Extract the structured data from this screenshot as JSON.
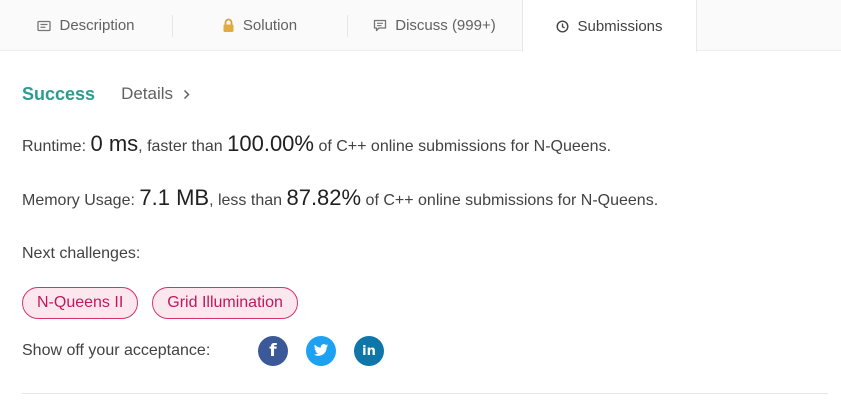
{
  "tabs": [
    {
      "label": "Description",
      "icon": "description-icon"
    },
    {
      "label": "Solution",
      "icon": "lock-icon"
    },
    {
      "label": "Discuss (999+)",
      "icon": "comment-icon"
    },
    {
      "label": "Submissions",
      "icon": "clock-icon",
      "active": true
    }
  ],
  "result": {
    "status": "Success",
    "details_label": "Details"
  },
  "runtime": {
    "label": "Runtime:",
    "value": "0 ms",
    "comparison": ", faster than",
    "percent": "100.00%",
    "suffix": "of C++ online submissions for N-Queens."
  },
  "memory": {
    "label": "Memory Usage:",
    "value": "7.1 MB",
    "comparison": ", less than",
    "percent": "87.82%",
    "suffix": "of C++ online submissions for N-Queens."
  },
  "next_challenges": {
    "label": "Next challenges:",
    "items": [
      "N-Queens II",
      "Grid Illumination"
    ]
  },
  "share": {
    "label": "Show off your acceptance:",
    "networks": [
      {
        "name": "facebook",
        "glyph": "f",
        "color": "#3b5998"
      },
      {
        "name": "twitter",
        "glyph": "t",
        "color": "#1da1f2"
      },
      {
        "name": "linkedin",
        "glyph": "in",
        "color": "#0e76a8"
      }
    ]
  },
  "colors": {
    "success": "#2c9c91",
    "chip_border": "#d6336c",
    "chip_bg": "#fde7ef",
    "chip_text": "#c2185b"
  }
}
